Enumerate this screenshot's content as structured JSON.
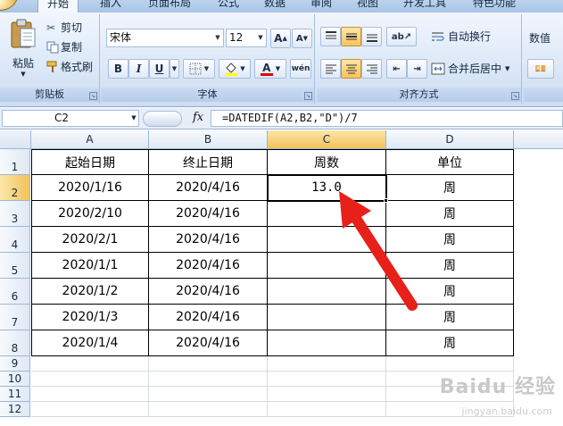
{
  "ribbon_tabs": [
    {
      "label": "开始",
      "active": true
    },
    {
      "label": "插入",
      "active": false
    },
    {
      "label": "页面布局",
      "active": false
    },
    {
      "label": "公式",
      "active": false
    },
    {
      "label": "数据",
      "active": false
    },
    {
      "label": "审阅",
      "active": false
    },
    {
      "label": "视图",
      "active": false
    },
    {
      "label": "开发工具",
      "active": false
    },
    {
      "label": "特色功能",
      "active": false
    }
  ],
  "clipboard": {
    "paste_label": "粘贴",
    "cut_label": "剪切",
    "copy_label": "复制",
    "format_painter_label": "格式刷",
    "group_label": "剪贴板"
  },
  "font": {
    "font_name": "宋体",
    "font_size": "12",
    "grow_label": "A",
    "shrink_label": "A",
    "bold_label": "B",
    "italic_label": "I",
    "underline_label": "U",
    "font_color_label": "A",
    "phonetic_label": "wén",
    "group_label": "字体",
    "colors": {
      "highlight": "#ffff00",
      "font_color": "#e00000"
    }
  },
  "alignment": {
    "wrap_text_label": "自动换行",
    "merge_center_label": "合并后居中",
    "group_label": "对齐方式"
  },
  "number": {
    "format_value": "数值"
  },
  "formula_bar": {
    "name_box": "C2",
    "fx_label": "fx",
    "formula": "=DATEDIF(A2,B2,\"D\")/7"
  },
  "sheet": {
    "columns": [
      "A",
      "B",
      "C",
      "D"
    ],
    "selected_column": "C",
    "selected_row": "2",
    "row_numbers": [
      "1",
      "2",
      "3",
      "4",
      "5",
      "6",
      "7",
      "8",
      "9",
      "10",
      "11",
      "12"
    ],
    "headers": [
      "起始日期",
      "终止日期",
      "周数",
      "单位"
    ],
    "rows": [
      [
        "2020/1/16",
        "2020/4/16",
        "13.0",
        "周"
      ],
      [
        "2020/2/10",
        "2020/4/16",
        "",
        "周"
      ],
      [
        "2020/2/1",
        "2020/4/16",
        "",
        "周"
      ],
      [
        "2020/1/1",
        "2020/4/16",
        "",
        "周"
      ],
      [
        "2020/1/2",
        "2020/4/16",
        "",
        "周"
      ],
      [
        "2020/1/3",
        "2020/4/16",
        "",
        "周"
      ],
      [
        "2020/1/4",
        "2020/4/16",
        "",
        "周"
      ]
    ]
  },
  "annotation": {
    "arrow_color": "#e8201a"
  },
  "watermark": {
    "text": "Baidu 经验",
    "sub": "jingyan.baidu.com"
  }
}
